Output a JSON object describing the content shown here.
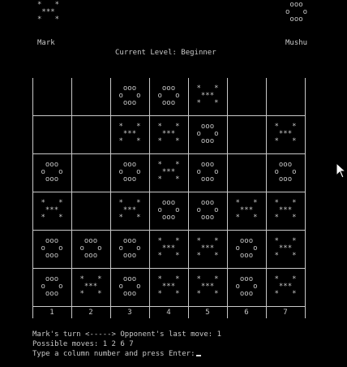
{
  "players": {
    "left": {
      "name": "Mark",
      "piece": "*   *\n ***\n*   *"
    },
    "right": {
      "name": "Mushu",
      "piece": " ooo\no   o\n ooo"
    }
  },
  "level_text": "Current Level: Beginner",
  "board": {
    "columns": [
      "1",
      "2",
      "3",
      "4",
      "5",
      "6",
      "7"
    ],
    "rows": [
      [
        "",
        "",
        "o",
        "o",
        "x",
        "",
        ""
      ],
      [
        "",
        "",
        "x",
        "x",
        "o",
        "",
        "x"
      ],
      [
        "o",
        "",
        "o",
        "x",
        "o",
        "",
        "o"
      ],
      [
        "x",
        "",
        "x",
        "o",
        "o",
        "x",
        "x"
      ],
      [
        "o",
        "o",
        "o",
        "x",
        "x",
        "o",
        "x"
      ],
      [
        "o",
        "x",
        "o",
        "x",
        "x",
        "o",
        "x"
      ]
    ],
    "pieces": {
      "x": "*   *\n ***\n*   *",
      "o": " ooo\no   o\n ooo"
    }
  },
  "status": {
    "turn_line": "Mark's turn <-----> Opponent's last move: 1",
    "moves_line": "Possible moves: 1 2 6 7",
    "prompt_line": "Type a column number and press Enter:"
  }
}
